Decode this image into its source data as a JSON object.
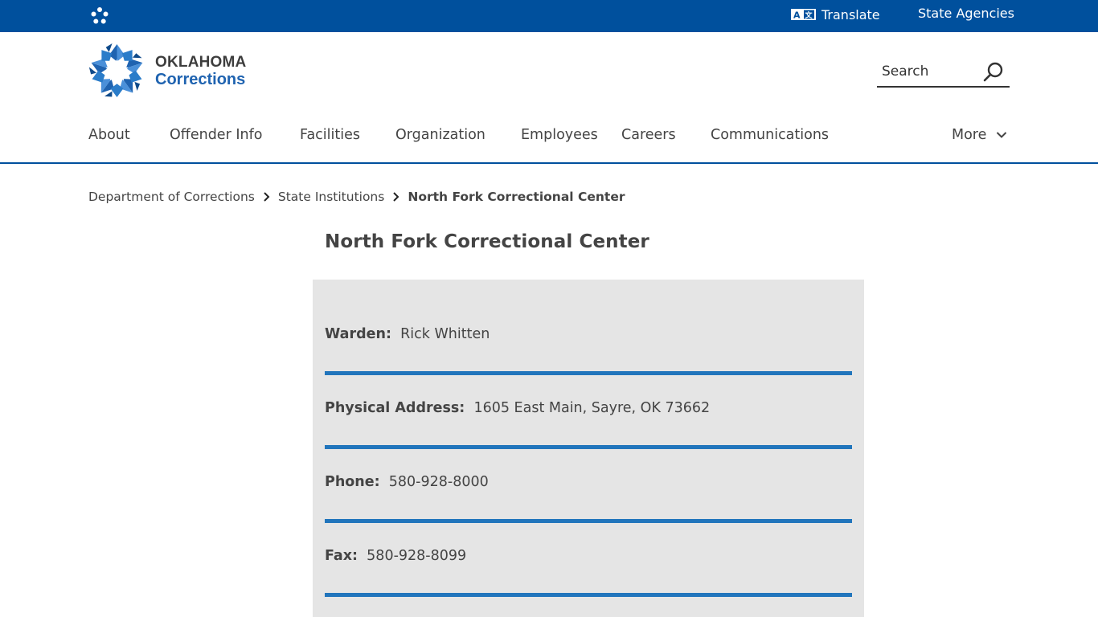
{
  "topbar": {
    "translate_label": "Translate",
    "translate_icon": "translate-icon",
    "state_agencies_label": "State Agencies",
    "mini_logo_icon": "oklahoma-star-icon"
  },
  "header": {
    "logo_line1": "OKLAHOMA",
    "logo_line2": "Corrections",
    "search_placeholder": "Search",
    "search_value": "",
    "search_icon": "search-icon"
  },
  "nav": {
    "items": [
      {
        "label": "About"
      },
      {
        "label": "Offender Info"
      },
      {
        "label": "Facilities"
      },
      {
        "label": "Organization"
      },
      {
        "label": "Employees"
      },
      {
        "label": "Careers"
      },
      {
        "label": "Communications"
      }
    ],
    "more_label": "More",
    "more_icon": "chevron-down-icon"
  },
  "breadcrumb": {
    "items": [
      {
        "label": "Department of Corrections"
      },
      {
        "label": "State Institutions"
      }
    ],
    "current": "North Fork Correctional Center",
    "separator_icon": "chevron-right-icon"
  },
  "page": {
    "title": "North Fork Correctional Center"
  },
  "info": {
    "rows": [
      {
        "label": "Warden:",
        "value": "Rick Whitten"
      },
      {
        "label": "Physical Address:",
        "value": "1605 East Main, Sayre, OK 73662"
      },
      {
        "label": "Phone:",
        "value": "580-928-8000"
      },
      {
        "label": "Fax:",
        "value": "580-928-8099"
      }
    ]
  },
  "colors": {
    "brand_blue": "#00509d",
    "accent_blue": "#2175bc",
    "logo_blue": "#1f63b0",
    "info_background": "#e5e5e5",
    "text": "#444444"
  }
}
